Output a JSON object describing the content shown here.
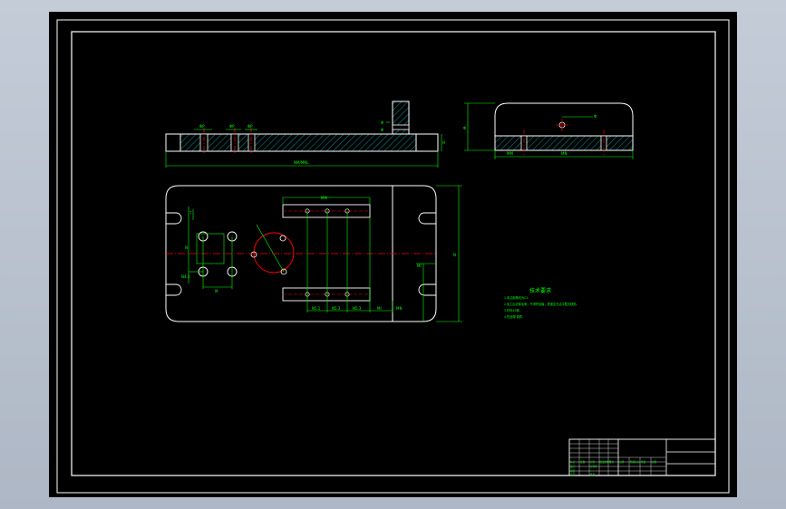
{
  "drawing": {
    "colors": {
      "background": "#000000",
      "border": "#ffffff",
      "dimension": "#00ff00",
      "centerline": "#ff0000",
      "outline": "#ffffff",
      "hatch": "#00ffff"
    },
    "front_view": {
      "dims": [
        "ΦP",
        "ΦP",
        "ΦP",
        "Φ",
        "Φ",
        "H",
        "Φ",
        "R"
      ],
      "overall_width": "NM/MNL"
    },
    "side_view": {
      "dim_height": "Φ",
      "dim_left": "MM",
      "dim_right": "MN",
      "dim_hole": "Φ"
    },
    "plan_view": {
      "dim_top": "MM",
      "dim_bottom": [
        "N5.1",
        "N5.3",
        "N5.3",
        "MI",
        "MN"
      ],
      "dim_left": [
        "T",
        "N",
        "M",
        "N4.3"
      ],
      "dim_right": "N",
      "dim_right_small": "MI"
    },
    "tech_notes": {
      "title": "技术要求",
      "lines": [
        "1.未注倒角均为C1.",
        "2.加工后去除毛刺，不得有划痕，表面应光洁平整无缺陷.",
        "3.材料45钢.",
        "4.热处理 调质."
      ]
    },
    "title_block": {
      "cells": [
        "标记",
        "处数",
        "分区",
        "更改文件号",
        "签名",
        "日期",
        "设计",
        "标准化",
        "审核",
        "工艺",
        "批准",
        "阶段标记",
        "重量",
        "比例"
      ]
    }
  }
}
